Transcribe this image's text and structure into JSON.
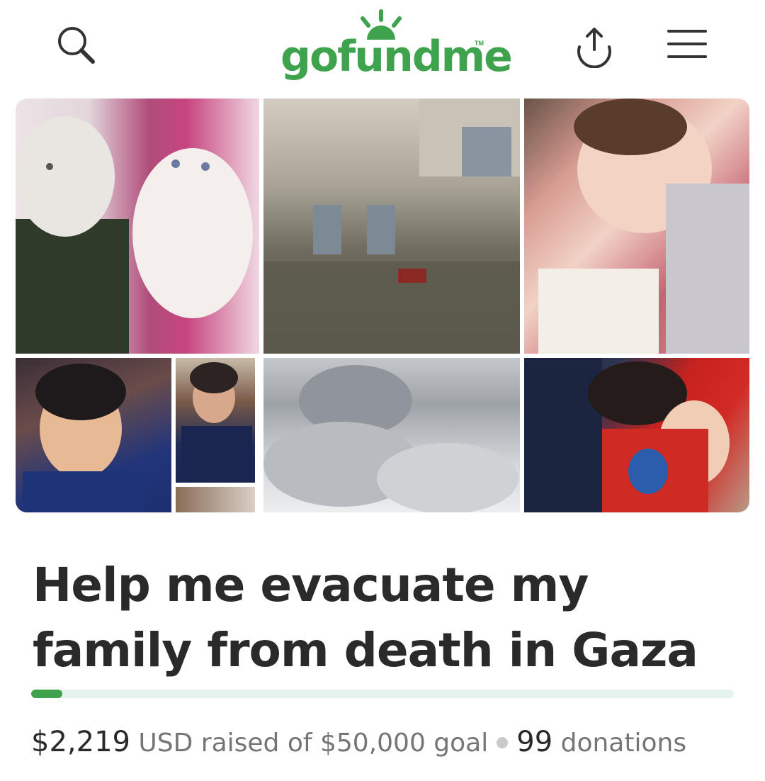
{
  "header": {
    "logo_text": "gofundme",
    "logo_tm": "TM",
    "icons": [
      "search-icon",
      "share-icon",
      "menu-icon"
    ],
    "brand_color": "#3fa34d"
  },
  "campaign": {
    "title": "Help me evacuate my family from death in Gaza",
    "progress_fraction": 0.044,
    "raised_amount": "$2,219",
    "raised_text": "USD raised of $50,000 goal",
    "donation_count": "99",
    "donations_label": "donations"
  },
  "colors": {
    "accent": "#3fa34d",
    "progress_track": "#e6f3ec",
    "title": "#2a2a2a",
    "muted": "#757575"
  }
}
